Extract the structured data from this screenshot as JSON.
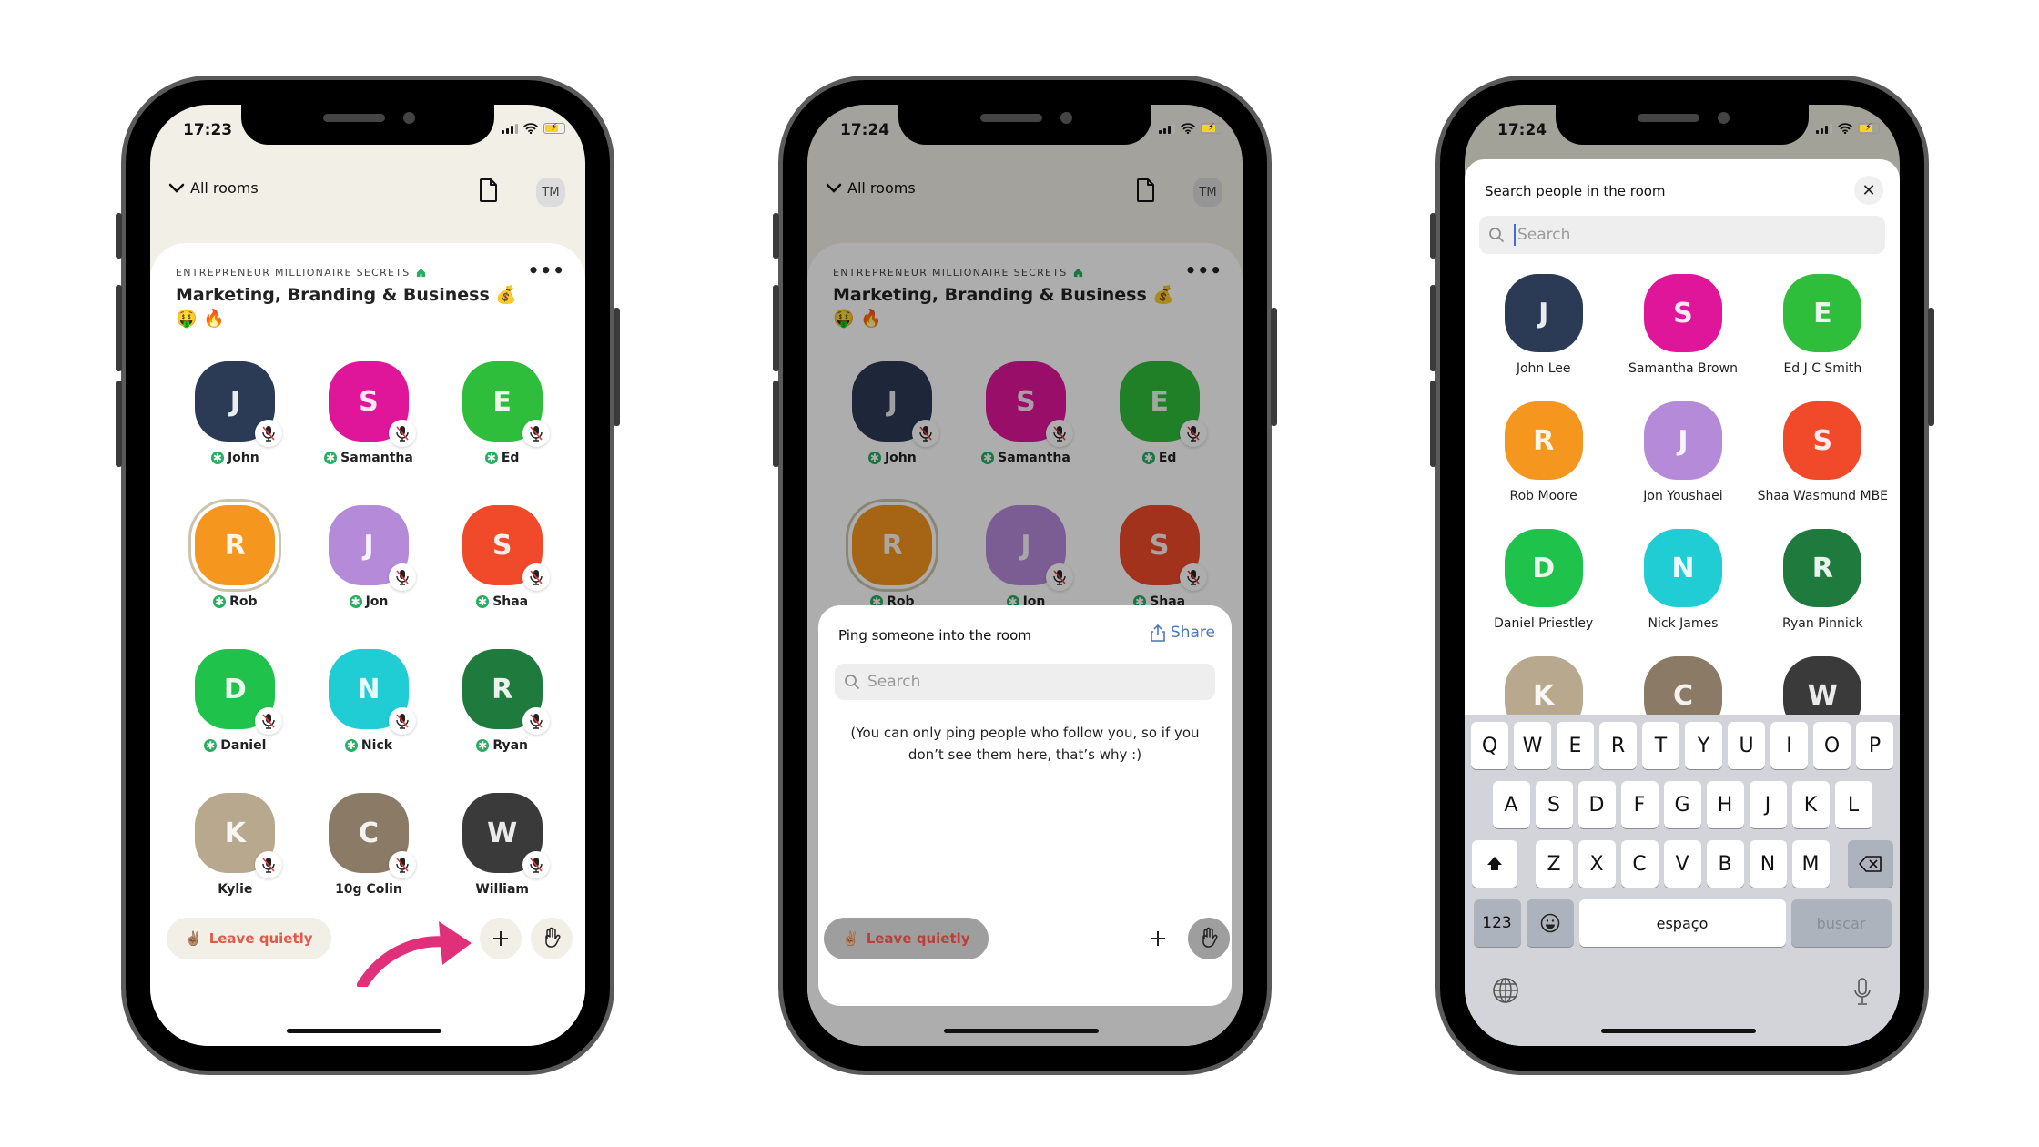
{
  "phones": [
    {
      "status": {
        "time": "17:23"
      },
      "nav": {
        "back_label": "All rooms",
        "avatar_initials": "TM"
      },
      "room": {
        "club": "ENTREPRENEUR MILLIONAIRE SECRETS",
        "title": "Marketing, Branding & Business 💰🤑 🔥",
        "speakers": [
          {
            "name": "John",
            "moderator": true,
            "muted": true,
            "color": "#2b3a55",
            "initial": "J"
          },
          {
            "name": "Samantha",
            "moderator": true,
            "muted": true,
            "color": "#e0169a",
            "initial": "S"
          },
          {
            "name": "Ed",
            "moderator": true,
            "muted": true,
            "color": "#2fbd3c",
            "initial": "E"
          },
          {
            "name": "Rob",
            "moderator": true,
            "muted": false,
            "color": "#f5961e",
            "initial": "R"
          },
          {
            "name": "Jon",
            "moderator": true,
            "muted": true,
            "color": "#b58ad9",
            "initial": "J"
          },
          {
            "name": "Shaa",
            "moderator": true,
            "muted": true,
            "color": "#f04a2a",
            "initial": "S"
          },
          {
            "name": "Daniel",
            "moderator": true,
            "muted": true,
            "color": "#1fc24a",
            "initial": "D"
          },
          {
            "name": "Nick",
            "moderator": true,
            "muted": true,
            "color": "#20cdd5",
            "initial": "N"
          },
          {
            "name": "Ryan",
            "moderator": true,
            "muted": true,
            "color": "#1f7a3d",
            "initial": "R"
          },
          {
            "name": "Kylie",
            "moderator": false,
            "muted": true,
            "color": "#b8a88e",
            "initial": "K"
          },
          {
            "name": "10g Colin",
            "moderator": false,
            "muted": true,
            "color": "#8a7a66",
            "initial": "C"
          },
          {
            "name": "William",
            "moderator": false,
            "muted": true,
            "color": "#3a3a3a",
            "initial": "W"
          }
        ]
      },
      "bottom": {
        "leave_label": "Leave quietly",
        "leave_emoji": "✌🏽"
      }
    },
    {
      "status": {
        "time": "17:24"
      },
      "nav": {
        "back_label": "All rooms",
        "avatar_initials": "TM"
      },
      "room": {
        "club": "ENTREPRENEUR MILLIONAIRE SECRETS",
        "title": "Marketing, Branding & Business 💰🤑 🔥"
      },
      "ping_sheet": {
        "title": "Ping someone into the room",
        "share_label": "Share",
        "search_placeholder": "Search",
        "note": "(You can only ping people who follow you, so if you don’t see them here, that’s why :)"
      },
      "bottom": {
        "leave_label": "Leave quietly",
        "leave_emoji": "✌🏽"
      }
    },
    {
      "status": {
        "time": "17:24"
      },
      "search_sheet": {
        "title": "Search people in the room",
        "search_placeholder": "Search",
        "people": [
          {
            "name": "John Lee",
            "color": "#2b3a55",
            "initial": "J"
          },
          {
            "name": "Samantha Brown",
            "color": "#e0169a",
            "initial": "S"
          },
          {
            "name": "Ed J C Smith",
            "color": "#2fbd3c",
            "initial": "E"
          },
          {
            "name": "Rob Moore",
            "color": "#f5961e",
            "initial": "R"
          },
          {
            "name": "Jon Youshaei",
            "color": "#b58ad9",
            "initial": "J"
          },
          {
            "name": "Shaa Wasmund MBE",
            "color": "#f04a2a",
            "initial": "S"
          },
          {
            "name": "Daniel Priestley",
            "color": "#1fc24a",
            "initial": "D"
          },
          {
            "name": "Nick James",
            "color": "#20cdd5",
            "initial": "N"
          },
          {
            "name": "Ryan Pinnick",
            "color": "#1f7a3d",
            "initial": "R"
          },
          {
            "name": "",
            "color": "#b8a88e",
            "initial": "K"
          },
          {
            "name": "",
            "color": "#8a7a66",
            "initial": "C"
          },
          {
            "name": "",
            "color": "#3a3a3a",
            "initial": "W"
          }
        ]
      },
      "keyboard": {
        "row1": [
          "Q",
          "W",
          "E",
          "R",
          "T",
          "Y",
          "U",
          "I",
          "O",
          "P"
        ],
        "row2": [
          "A",
          "S",
          "D",
          "F",
          "G",
          "H",
          "J",
          "K",
          "L"
        ],
        "row3": [
          "Z",
          "X",
          "C",
          "V",
          "B",
          "N",
          "M"
        ],
        "numbers_label": "123",
        "space_label": "espaço",
        "return_label": "buscar"
      }
    }
  ],
  "annotation": {
    "arrow_color": "#e0307a"
  }
}
